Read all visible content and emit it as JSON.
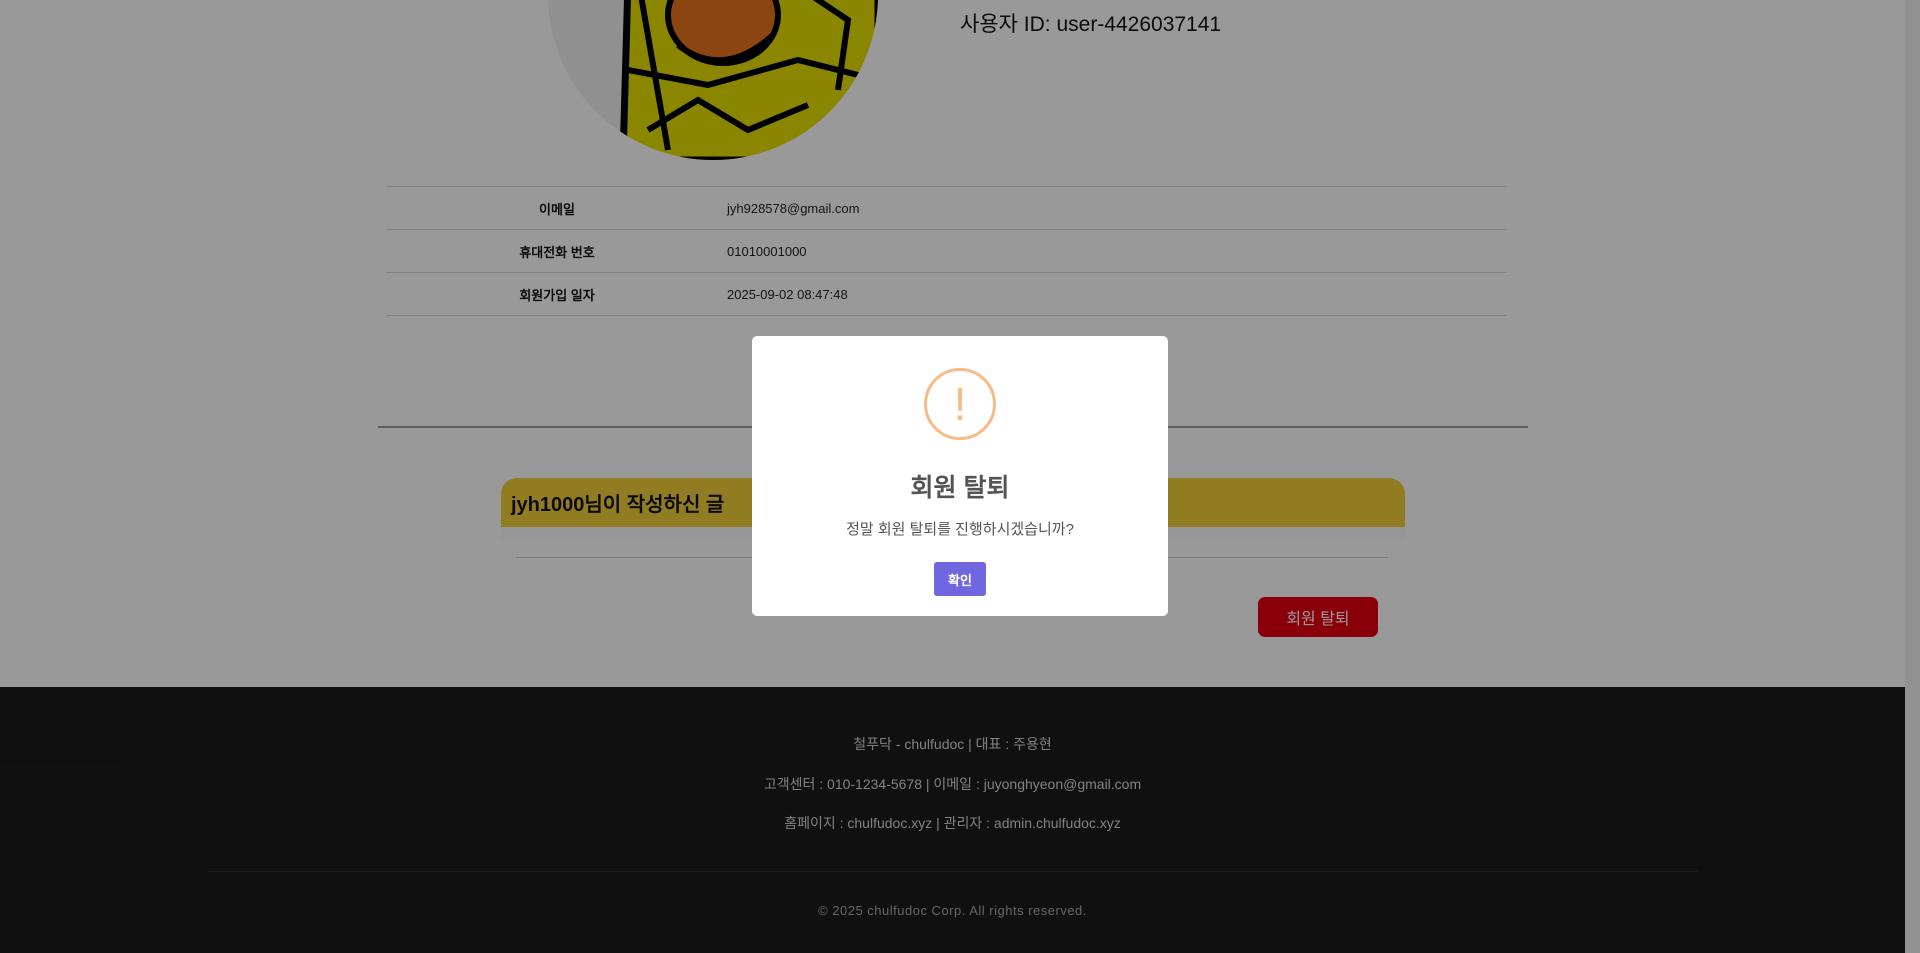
{
  "profile": {
    "user_id_text": "사용자 ID: user-4426037141"
  },
  "info": {
    "rows": [
      {
        "label": "이메일",
        "value": "jyh928578@gmail.com"
      },
      {
        "label": "휴대전화 번호",
        "value": "01010001000"
      },
      {
        "label": "회원가입 일자",
        "value": "2025-09-02 08:47:48"
      }
    ]
  },
  "posts": {
    "title": "jyh1000님이 작성하신 글"
  },
  "actions": {
    "withdraw_label": "회원 탈퇴",
    "withdraw_color": "#e60012"
  },
  "footer": {
    "line1": "철푸닥 - chulfudoc | 대표 : 주용현",
    "line2": "고객센터 : 010-1234-5678 | 이메일 : juyonghyeon@gmail.com",
    "line3": "홈페이지 : chulfudoc.xyz | 관리자 : admin.chulfudoc.xyz",
    "copyright": "© 2025 chulfudoc Corp. All rights reserved."
  },
  "modal": {
    "icon": "warning-icon",
    "icon_glyph": "!",
    "title": "회원 탈퇴",
    "text": "정말 회원 탈퇴를 진행하시겠습니까?",
    "confirm_label": "확인",
    "confirm_color": "#7066e0"
  }
}
